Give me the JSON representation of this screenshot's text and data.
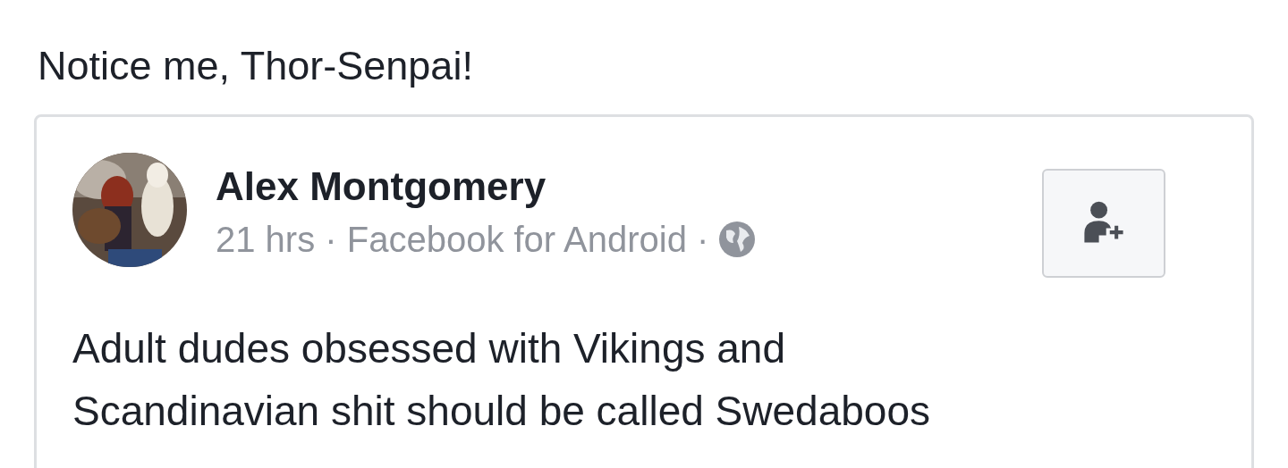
{
  "caption": "Notice me, Thor-Senpai!",
  "shared_post": {
    "author": "Alex Montgomery",
    "meta": "21 hrs · Facebook for Android ·",
    "text_lines": [
      "Adult dudes obsessed with Vikings and",
      "Scandinavian shit should be called Swedaboos"
    ]
  }
}
